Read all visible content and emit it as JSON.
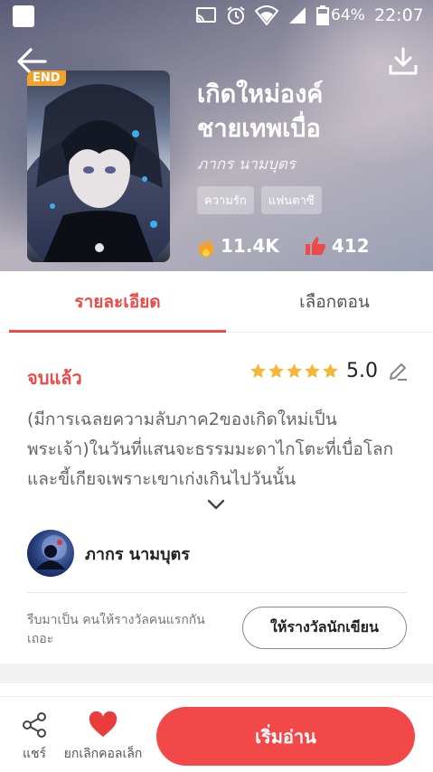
{
  "status_bar": {
    "battery_percent": "64%",
    "time": "22:07",
    "icons": [
      "app-square-icon",
      "cast-icon",
      "alarm-icon",
      "wifi-icon",
      "signal-icon",
      "battery-icon"
    ]
  },
  "header": {
    "end_badge": "END",
    "title_line1": "เกิดใหม่องค์",
    "title_line2": "ชายเทพเบื่อ",
    "author": "ภากร นามบุตร",
    "tags": [
      "ความรัก",
      "แฟนตาซี"
    ],
    "views": "11.4K",
    "likes": "412"
  },
  "tabs": {
    "details": "รายละเอียด",
    "episodes": "เลือกตอน"
  },
  "details": {
    "status": "จบแล้ว",
    "rating_value": "5.0",
    "rating_stars": 5,
    "synopsis": "(มีการเฉลยความลับภาค2ของเกิดใหม่เป็นพระเจ้า)ในวันที่แสนจะธรรมมะดาไกโตะที่เบื่อโลกและขี้เกียจเพราะเขาเก่งเกินไปวันนั้น"
  },
  "author_section": {
    "name": "ภากร นามบุตร",
    "reward_prompt": "รีบมาเป็น คนให้รางวัลคนแรกกันเถอะ",
    "reward_button": "ให้รางวัลนักเขียน"
  },
  "bottom_bar": {
    "share_label": "แชร์",
    "unfavorite_label": "ยกเลิกคอลเล็ก",
    "read_button": "เริ่มอ่าน"
  },
  "colors": {
    "accent": "#ea4a4a",
    "read_button": "#f24848",
    "star": "#f5b73b",
    "end_badge": "#f2a22b"
  }
}
